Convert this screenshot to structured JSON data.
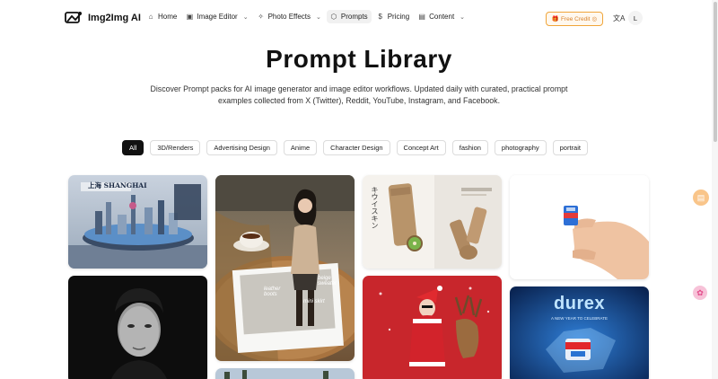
{
  "brand": {
    "name": "Img2Img AI"
  },
  "nav": {
    "items": [
      {
        "label": "Home",
        "icon": "home-icon",
        "glyph": "⌂",
        "dropdown": false,
        "active": false
      },
      {
        "label": "Image Editor",
        "icon": "image-icon",
        "glyph": "▣",
        "dropdown": true,
        "active": false
      },
      {
        "label": "Photo Effects",
        "icon": "sparkle-icon",
        "glyph": "✧",
        "dropdown": true,
        "active": false
      },
      {
        "label": "Prompts",
        "icon": "cube-icon",
        "glyph": "⬡",
        "dropdown": false,
        "active": true
      },
      {
        "label": "Pricing",
        "icon": "dollar-icon",
        "glyph": "$",
        "dropdown": false,
        "active": false
      },
      {
        "label": "Content",
        "icon": "document-icon",
        "glyph": "▤",
        "dropdown": true,
        "active": false
      }
    ],
    "credit_label": "Free Credit",
    "lang_glyph": "文A",
    "avatar_initial": "L"
  },
  "hero": {
    "title": "Prompt Library",
    "subtitle": "Discover Prompt packs for AI image generator and image editor workflows. Updated daily with curated, practical prompt examples collected from X (Twitter), Reddit, YouTube, Instagram, and Facebook."
  },
  "filters": [
    "All",
    "3D/Renders",
    "Advertising Design",
    "Anime",
    "Character Design",
    "Concept Art",
    "fashion",
    "photography",
    "portrait"
  ],
  "active_filter": "All",
  "cards": {
    "shanghai": {
      "caption": "上海 SHANGHAI"
    },
    "cafe": {
      "notes": [
        "leather boots",
        "beige sweater",
        "mini skirt"
      ]
    },
    "kiwi": {
      "caption": "キウイスキン"
    },
    "durex": {
      "caption": "durex",
      "sub": "A NEW YEAR TO CELEBRATE"
    }
  },
  "colors": {
    "accent": "#f0a53a",
    "active_chip": "#111111",
    "float_orange": "#f7a23e",
    "float_pink": "#f46aa0"
  }
}
